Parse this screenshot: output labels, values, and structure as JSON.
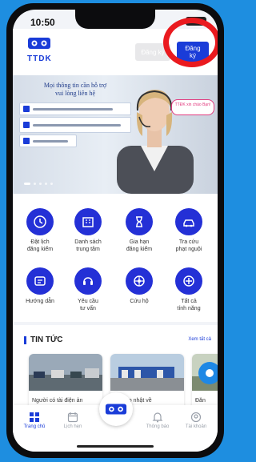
{
  "status": {
    "time": "10:50"
  },
  "header": {
    "logo_text": "TTDK",
    "register_label": "Đăng ký",
    "login_label": "Đăng ký"
  },
  "banner": {
    "title_line1": "Mọi thông tin cần hỗ trợ",
    "title_line2": "vui lòng liên hệ",
    "bubble_text": "TTĐK xin chào Bạn!"
  },
  "features": [
    {
      "label_1": "Đặt lịch",
      "label_2": "đăng kiểm",
      "icon": "clock-icon"
    },
    {
      "label_1": "Danh sách",
      "label_2": "trung tâm",
      "icon": "building-icon"
    },
    {
      "label_1": "Gia hạn",
      "label_2": "đăng kiểm",
      "icon": "hourglass-icon"
    },
    {
      "label_1": "Tra cứu",
      "label_2": "phạt nguội",
      "icon": "car-icon"
    },
    {
      "label_1": "Hướng dẫn",
      "label_2": "",
      "icon": "guide-icon"
    },
    {
      "label_1": "Yêu cầu",
      "label_2": "tư vấn",
      "icon": "support-icon"
    },
    {
      "label_1": "Cứu hộ",
      "label_2": "",
      "icon": "wheel-icon"
    },
    {
      "label_1": "Tất cả",
      "label_2": "tính năng",
      "icon": "all-features-icon"
    }
  ],
  "news": {
    "title": "TIN TỨC",
    "see_all": "Xem tất cả",
    "cards": [
      {
        "caption": "Người có tài điện ản"
      },
      {
        "caption": "Tin cập nhật về"
      },
      {
        "caption": "Đăn"
      }
    ]
  },
  "bottom_nav": [
    {
      "label": "Trang chủ",
      "icon": "home-grid-icon"
    },
    {
      "label": "Lịch hẹn",
      "icon": "calendar-icon"
    },
    {
      "label": "Thông báo",
      "icon": "bell-icon"
    },
    {
      "label": "Tài khoản",
      "icon": "account-icon"
    }
  ],
  "colors": {
    "primary": "#2430d6",
    "accent_red": "#ea1a1f",
    "background": "#1e8ee0"
  }
}
